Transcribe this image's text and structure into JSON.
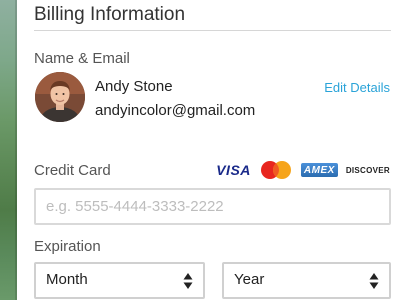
{
  "billing": {
    "title": "Billing Information",
    "name_email_label": "Name & Email",
    "user": {
      "name": "Andy Stone",
      "email": "andyincolor@gmail.com"
    },
    "edit_details": "Edit Details"
  },
  "credit_card": {
    "label": "Credit Card",
    "placeholder": "e.g. 5555-4444-3333-2222",
    "value": "",
    "logos": {
      "visa": "VISA",
      "mastercard": "MasterCard",
      "amex": "AMEX",
      "discover": "DISCOVER"
    }
  },
  "expiration": {
    "label": "Expiration",
    "month": "Month",
    "year": "Year"
  },
  "colors": {
    "accent": "#2aa3d8",
    "text": "#333333",
    "border": "#d9d9d9"
  }
}
